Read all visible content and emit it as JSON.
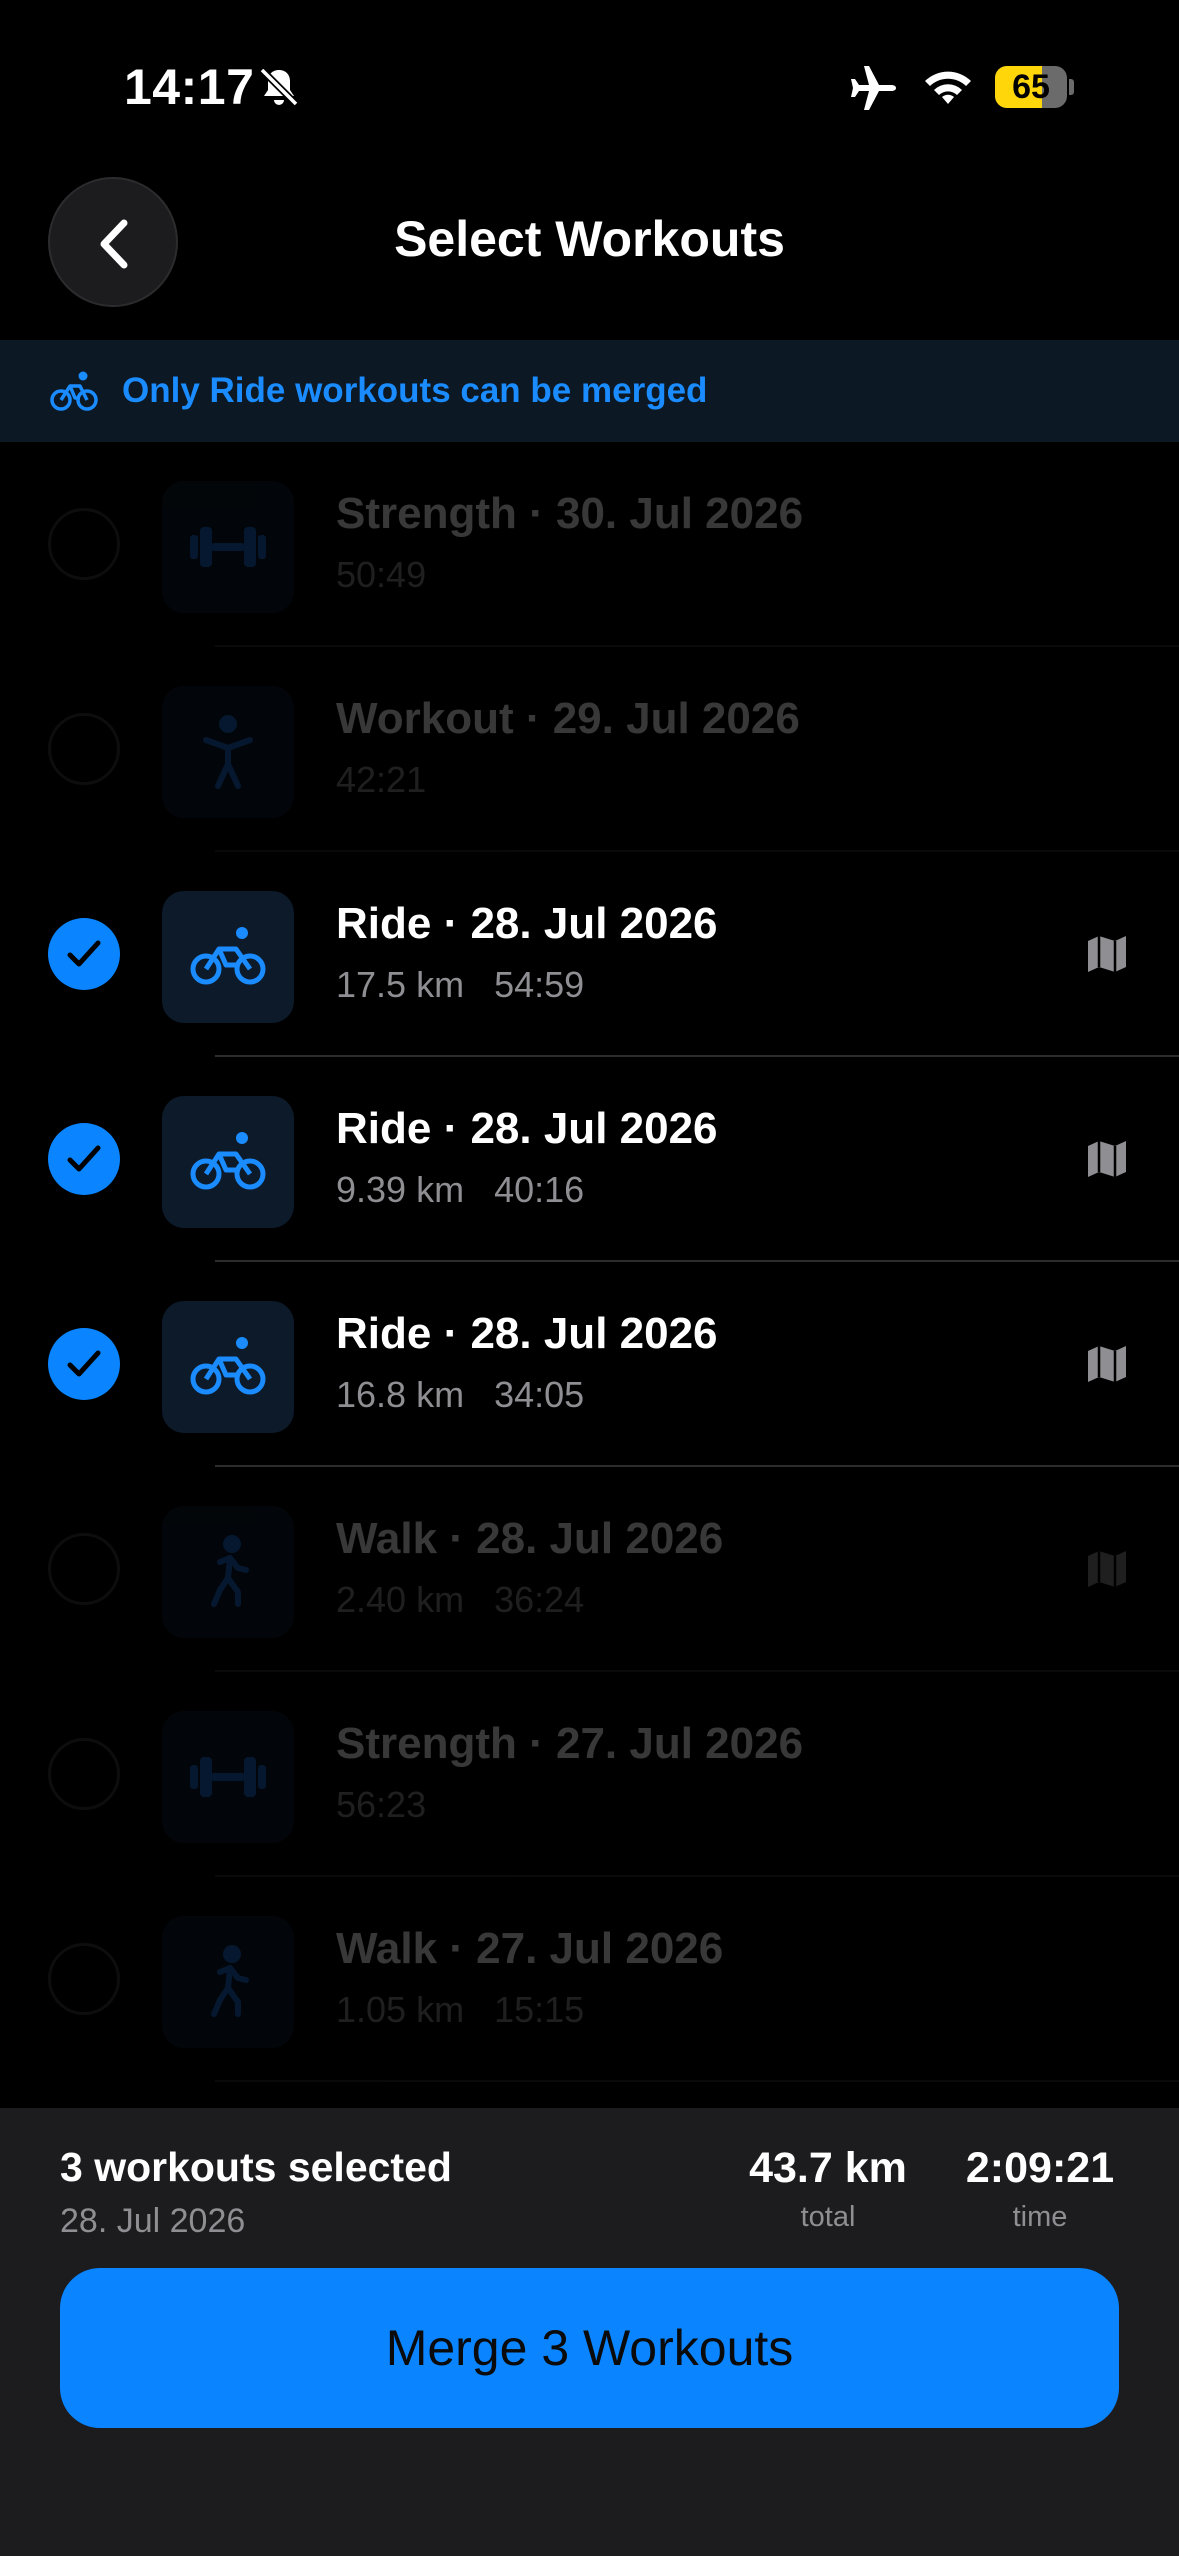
{
  "status_bar": {
    "time": "14:17",
    "battery_level": "65",
    "icons": [
      "bell-slash-icon",
      "airplane-icon",
      "wifi-icon",
      "battery-icon"
    ]
  },
  "header": {
    "title": "Select Workouts",
    "back_icon": "chevron-left-icon"
  },
  "banner": {
    "icon": "bicycle-icon",
    "text": "Only Ride workouts can be merged",
    "color": "#1a8cff"
  },
  "workouts": [
    {
      "type": "strength",
      "title": "Strength · 30. Jul 2026",
      "distance": "",
      "duration": "50:49",
      "selected": false,
      "enabled": false,
      "has_map": false
    },
    {
      "type": "workout",
      "title": "Workout · 29. Jul 2026",
      "distance": "",
      "duration": "42:21",
      "selected": false,
      "enabled": false,
      "has_map": false
    },
    {
      "type": "ride",
      "title": "Ride · 28. Jul 2026",
      "distance": "17.5 km",
      "duration": "54:59",
      "selected": true,
      "enabled": true,
      "has_map": true
    },
    {
      "type": "ride",
      "title": "Ride · 28. Jul 2026",
      "distance": "9.39 km",
      "duration": "40:16",
      "selected": true,
      "enabled": true,
      "has_map": true
    },
    {
      "type": "ride",
      "title": "Ride · 28. Jul 2026",
      "distance": "16.8 km",
      "duration": "34:05",
      "selected": true,
      "enabled": true,
      "has_map": true
    },
    {
      "type": "walk",
      "title": "Walk · 28. Jul 2026",
      "distance": "2.40 km",
      "duration": "36:24",
      "selected": false,
      "enabled": false,
      "has_map": true
    },
    {
      "type": "strength",
      "title": "Strength · 27. Jul 2026",
      "distance": "",
      "duration": "56:23",
      "selected": false,
      "enabled": false,
      "has_map": false
    },
    {
      "type": "walk",
      "title": "Walk · 27. Jul 2026",
      "distance": "1.05 km",
      "duration": "15:15",
      "selected": false,
      "enabled": false,
      "has_map": false
    }
  ],
  "footer": {
    "selected_count": "3 workouts selected",
    "selected_date": "28. Jul 2026",
    "total_distance": "43.7 km",
    "total_distance_label": "total",
    "total_time": "2:09:21",
    "total_time_label": "time",
    "merge_button": "Merge 3 Workouts"
  },
  "colors": {
    "accent": "#0a84ff",
    "background": "#000000",
    "footer_background": "#1c1c1e",
    "secondary_text": "#8e8e93"
  }
}
